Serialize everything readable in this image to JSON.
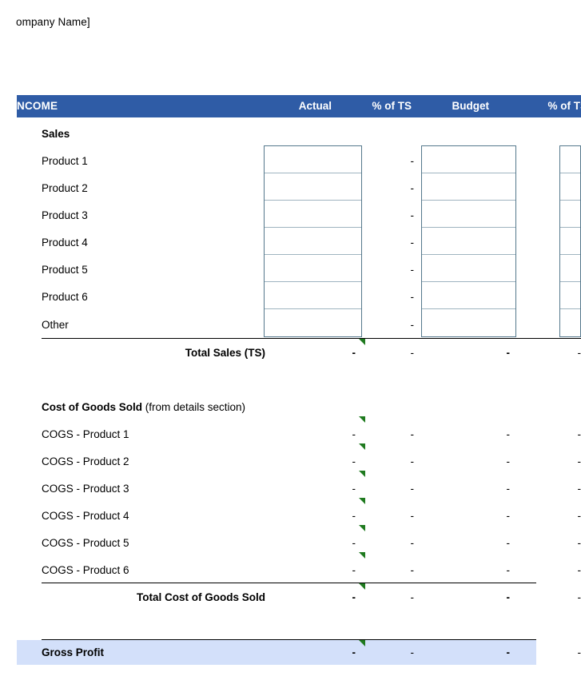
{
  "document": {
    "company_name": "ompany Name]",
    "section_title": "NCOME"
  },
  "columns": {
    "actual": "Actual",
    "pct_of_ts_1": "% of TS",
    "budget": "Budget",
    "pct_of_ts_2": "% of TS"
  },
  "sales": {
    "heading": "Sales",
    "rows": [
      {
        "label": "Product 1",
        "actual": "",
        "pct1": "-",
        "budget": "",
        "pct2": ""
      },
      {
        "label": "Product 2",
        "actual": "",
        "pct1": "-",
        "budget": "",
        "pct2": ""
      },
      {
        "label": "Product 3",
        "actual": "",
        "pct1": "-",
        "budget": "",
        "pct2": ""
      },
      {
        "label": "Product 4",
        "actual": "",
        "pct1": "-",
        "budget": "",
        "pct2": ""
      },
      {
        "label": "Product 5",
        "actual": "",
        "pct1": "-",
        "budget": "",
        "pct2": ""
      },
      {
        "label": "Product 6",
        "actual": "",
        "pct1": "-",
        "budget": "",
        "pct2": ""
      },
      {
        "label": "Other",
        "actual": "",
        "pct1": "-",
        "budget": "",
        "pct2": ""
      }
    ],
    "total": {
      "label": "Total Sales (TS)",
      "actual": "-",
      "pct1": "-",
      "budget": "-",
      "pct2": "-"
    }
  },
  "cogs": {
    "heading_bold": "Cost of Goods Sold",
    "heading_regular": " (from details section)",
    "rows": [
      {
        "label": "COGS - Product 1",
        "actual": "-",
        "pct1": "-",
        "budget": "-",
        "pct2": "-"
      },
      {
        "label": "COGS - Product 2",
        "actual": "-",
        "pct1": "-",
        "budget": "-",
        "pct2": "-"
      },
      {
        "label": "COGS - Product 3",
        "actual": "-",
        "pct1": "-",
        "budget": "-",
        "pct2": "-"
      },
      {
        "label": "COGS - Product 4",
        "actual": "-",
        "pct1": "-",
        "budget": "-",
        "pct2": "-"
      },
      {
        "label": "COGS - Product 5",
        "actual": "-",
        "pct1": "-",
        "budget": "-",
        "pct2": "-"
      },
      {
        "label": "COGS - Product 6",
        "actual": "-",
        "pct1": "-",
        "budget": "-",
        "pct2": "-"
      }
    ],
    "total": {
      "label": "Total Cost of Goods Sold",
      "actual": "-",
      "pct1": "-",
      "budget": "-",
      "pct2": "-"
    }
  },
  "gross_profit": {
    "label": "Gross Profit",
    "actual": "-",
    "pct1": "-",
    "budget": "-",
    "pct2": "-"
  },
  "colors": {
    "header_blue": "#2F5CA6",
    "gross_profit_blue": "#D3E0FA",
    "entry_border": "#55788C",
    "comment_triangle_green": "#1F7A1F"
  }
}
